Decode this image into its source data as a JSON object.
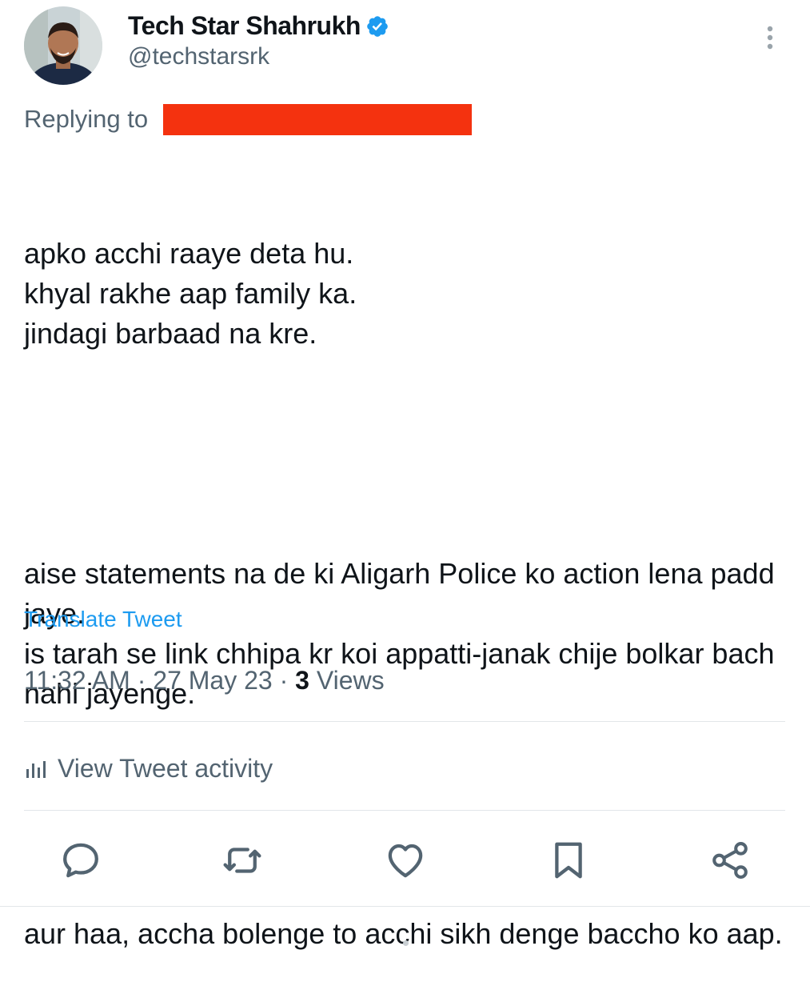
{
  "author": {
    "display_name": "Tech Star Shahrukh",
    "handle": "@techstarsrk",
    "verified": true,
    "verified_color": "#1d9bf0"
  },
  "reply": {
    "prefix": "Replying to",
    "redacted_color": "#f4320f"
  },
  "tweet": {
    "paragraphs": [
      "apko acchi raaye deta hu.\nkhyal rakhe aap family ka.\njindagi barbaad na kre.",
      "aise statements na de ki Aligarh Police ko action lena padd jaye.\nis tarah se link chhipa kr koi appatti-janak chije bolkar bach nahi jayenge.",
      "aur haa, accha bolenge to acchi sikh denge baccho ko aap."
    ],
    "translate_label": "Translate Tweet",
    "time": "11:32 AM",
    "separator": "·",
    "date": "27 May 23",
    "views_count": "3",
    "views_label": "Views"
  },
  "activity": {
    "label": "View Tweet activity",
    "icon": "bar-chart-icon"
  },
  "actions": [
    {
      "name": "reply",
      "icon": "reply-icon"
    },
    {
      "name": "retweet",
      "icon": "retweet-icon"
    },
    {
      "name": "like",
      "icon": "heart-icon"
    },
    {
      "name": "bookmark",
      "icon": "bookmark-icon"
    },
    {
      "name": "share",
      "icon": "share-icon"
    }
  ],
  "colors": {
    "primary_text": "#0f1419",
    "secondary_text": "#536471",
    "link": "#1d9bf0",
    "divider": "#e2e6e9"
  }
}
